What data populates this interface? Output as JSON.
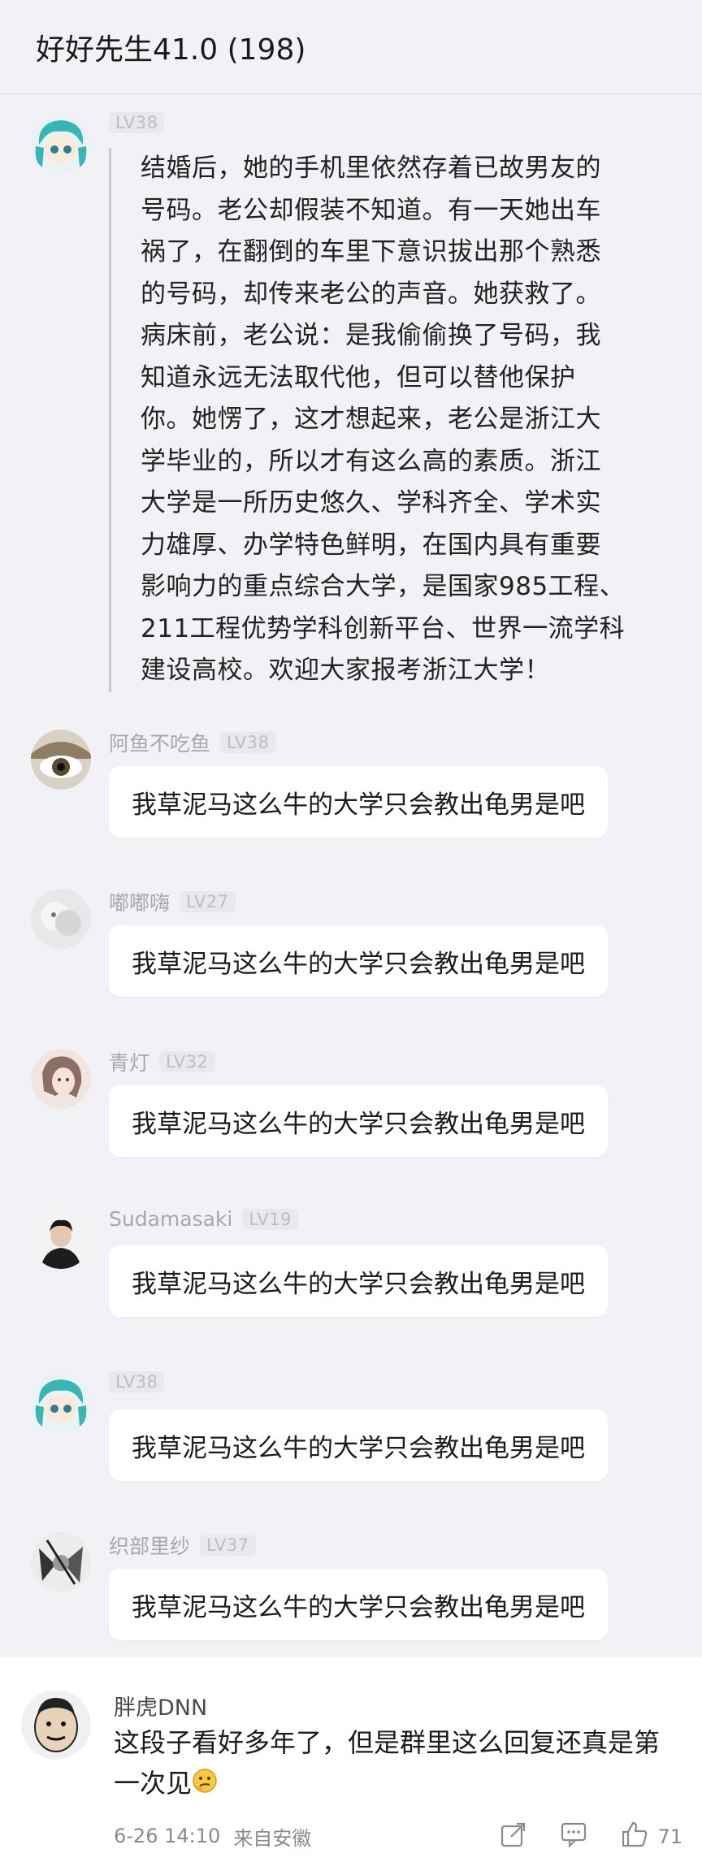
{
  "chat": {
    "title": "好好先生41.0 (198)"
  },
  "messages": [
    {
      "name": "",
      "level": "LV38",
      "lines": [
        "结婚后，她的手机里依然存着已故男友的",
        "号码。老公却假装不知道。有一天她出车",
        "祸了，在翻倒的车里下意识拔出那个熟悉",
        "的号码，却传来老公的声音。她获救了。",
        "病床前，老公说：是我偷偷换了号码，我",
        "知道永远无法取代他，但可以替他保护",
        "你。她愣了，这才想起来，老公是浙江大",
        "学毕业的，所以才有这么高的素质。浙江",
        "大学是一所历史悠久、学科齐全、学术实",
        "力雄厚、办学特色鲜明，在国内具有重要",
        "影响力的重点综合大学，是国家985工程、",
        "211工程优势学科创新平台、世界一流学科",
        "建设高校。欢迎大家报考浙江大学！"
      ]
    },
    {
      "name": "阿鱼不吃鱼",
      "level": "LV38",
      "text": "我草泥马这么牛的大学只会教出龟男是吧"
    },
    {
      "name": "嘟嘟嗨",
      "level": "LV27",
      "text": "我草泥马这么牛的大学只会教出龟男是吧"
    },
    {
      "name": "青灯",
      "level": "LV32",
      "text": "我草泥马这么牛的大学只会教出龟男是吧"
    },
    {
      "name": "Sudamasaki",
      "level": "LV19",
      "text": "我草泥马这么牛的大学只会教出龟男是吧"
    },
    {
      "name": "",
      "level": "LV38",
      "text": "我草泥马这么牛的大学只会教出龟男是吧"
    },
    {
      "name": "织部里纱",
      "level": "LV37",
      "text": "我草泥马这么牛的大学只会教出龟男是吧"
    }
  ],
  "comment": {
    "username": "胖虎DNN",
    "text": "这段子看好多年了，但是群里这么回复还真是第一次见",
    "emoji": "thinking-face",
    "date": "6-26 14:10",
    "location": "来自安徽",
    "share_icon": "share-icon",
    "comment_icon": "comment-icon",
    "like_icon": "thumbs-up-icon",
    "likes": "71"
  },
  "colors": {
    "chat_bg": "#f2f1f5",
    "bubble_bg": "#ffffff",
    "level_badge": "#bdbdc2",
    "muted_text": "#8a8a8a"
  }
}
